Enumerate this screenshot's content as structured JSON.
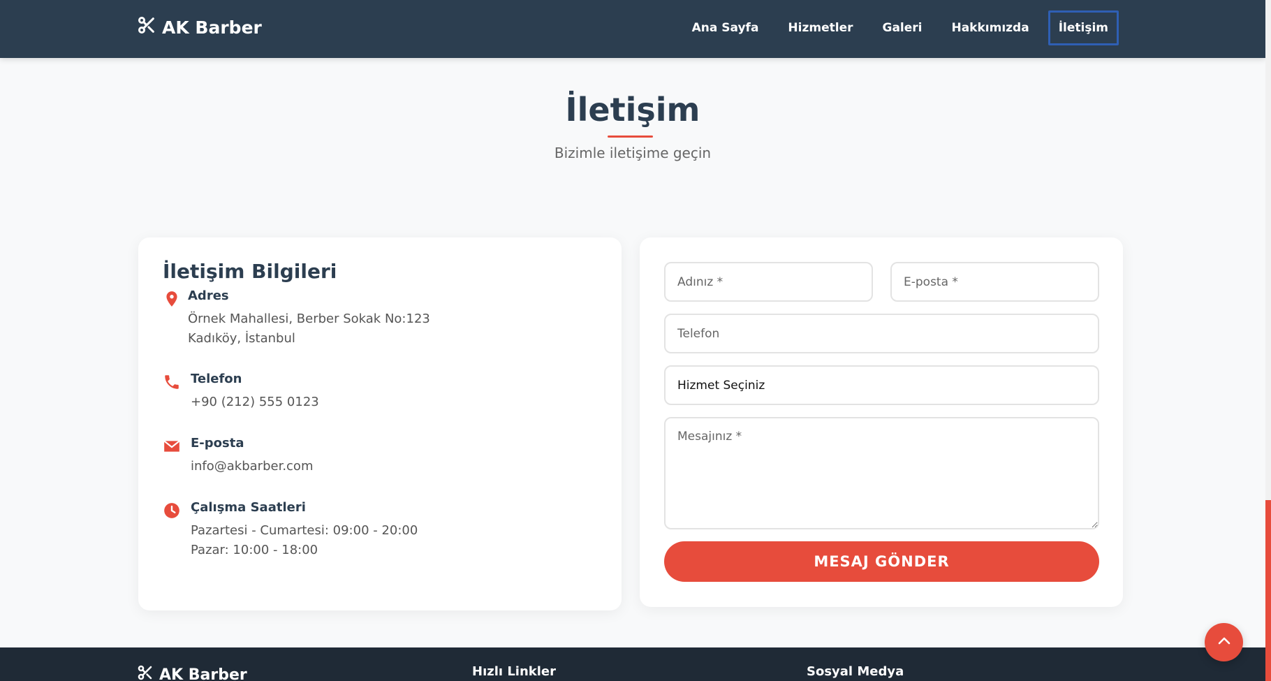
{
  "header": {
    "brand": "AK Barber",
    "nav": [
      {
        "label": "Ana Sayfa"
      },
      {
        "label": "Hizmetler"
      },
      {
        "label": "Galeri"
      },
      {
        "label": "Hakkımızda"
      },
      {
        "label": "İletişim",
        "active": true
      }
    ]
  },
  "section": {
    "title": "İletişim",
    "subtitle": "Bizimle iletişime geçin"
  },
  "contact_info": {
    "title": "İletişim Bilgileri",
    "address": {
      "label": "Adres",
      "lines": [
        "Örnek Mahallesi, Berber Sokak No:123",
        "Kadıköy, İstanbul"
      ]
    },
    "phone": {
      "label": "Telefon",
      "value": "+90 (212) 555 0123"
    },
    "email": {
      "label": "E-posta",
      "value": "info@akbarber.com"
    },
    "hours": {
      "label": "Çalışma Saatleri",
      "lines": [
        "Pazartesi - Cumartesi: 09:00 - 20:00",
        "Pazar: 10:00 - 18:00"
      ]
    }
  },
  "form": {
    "name_placeholder": "Adınız *",
    "email_placeholder": "E-posta *",
    "phone_placeholder": "Telefon",
    "service_select": "Hizmet Seçiniz",
    "message_placeholder": "Mesajınız *",
    "submit_label": "MESAJ GÖNDER"
  },
  "footer": {
    "brand": "AK Barber",
    "col1_title": "Hızlı Linkler",
    "col2_title": "Sosyal Medya"
  },
  "colors": {
    "header_bg": "#2c3e50",
    "accent": "#e74c3c",
    "footer_bg": "#1f2a36"
  },
  "icons": {
    "brand": "scissors-icon",
    "address": "map-pin-icon",
    "phone": "phone-icon",
    "email": "envelope-icon",
    "hours": "clock-icon",
    "to_top": "chevron-up-icon"
  }
}
